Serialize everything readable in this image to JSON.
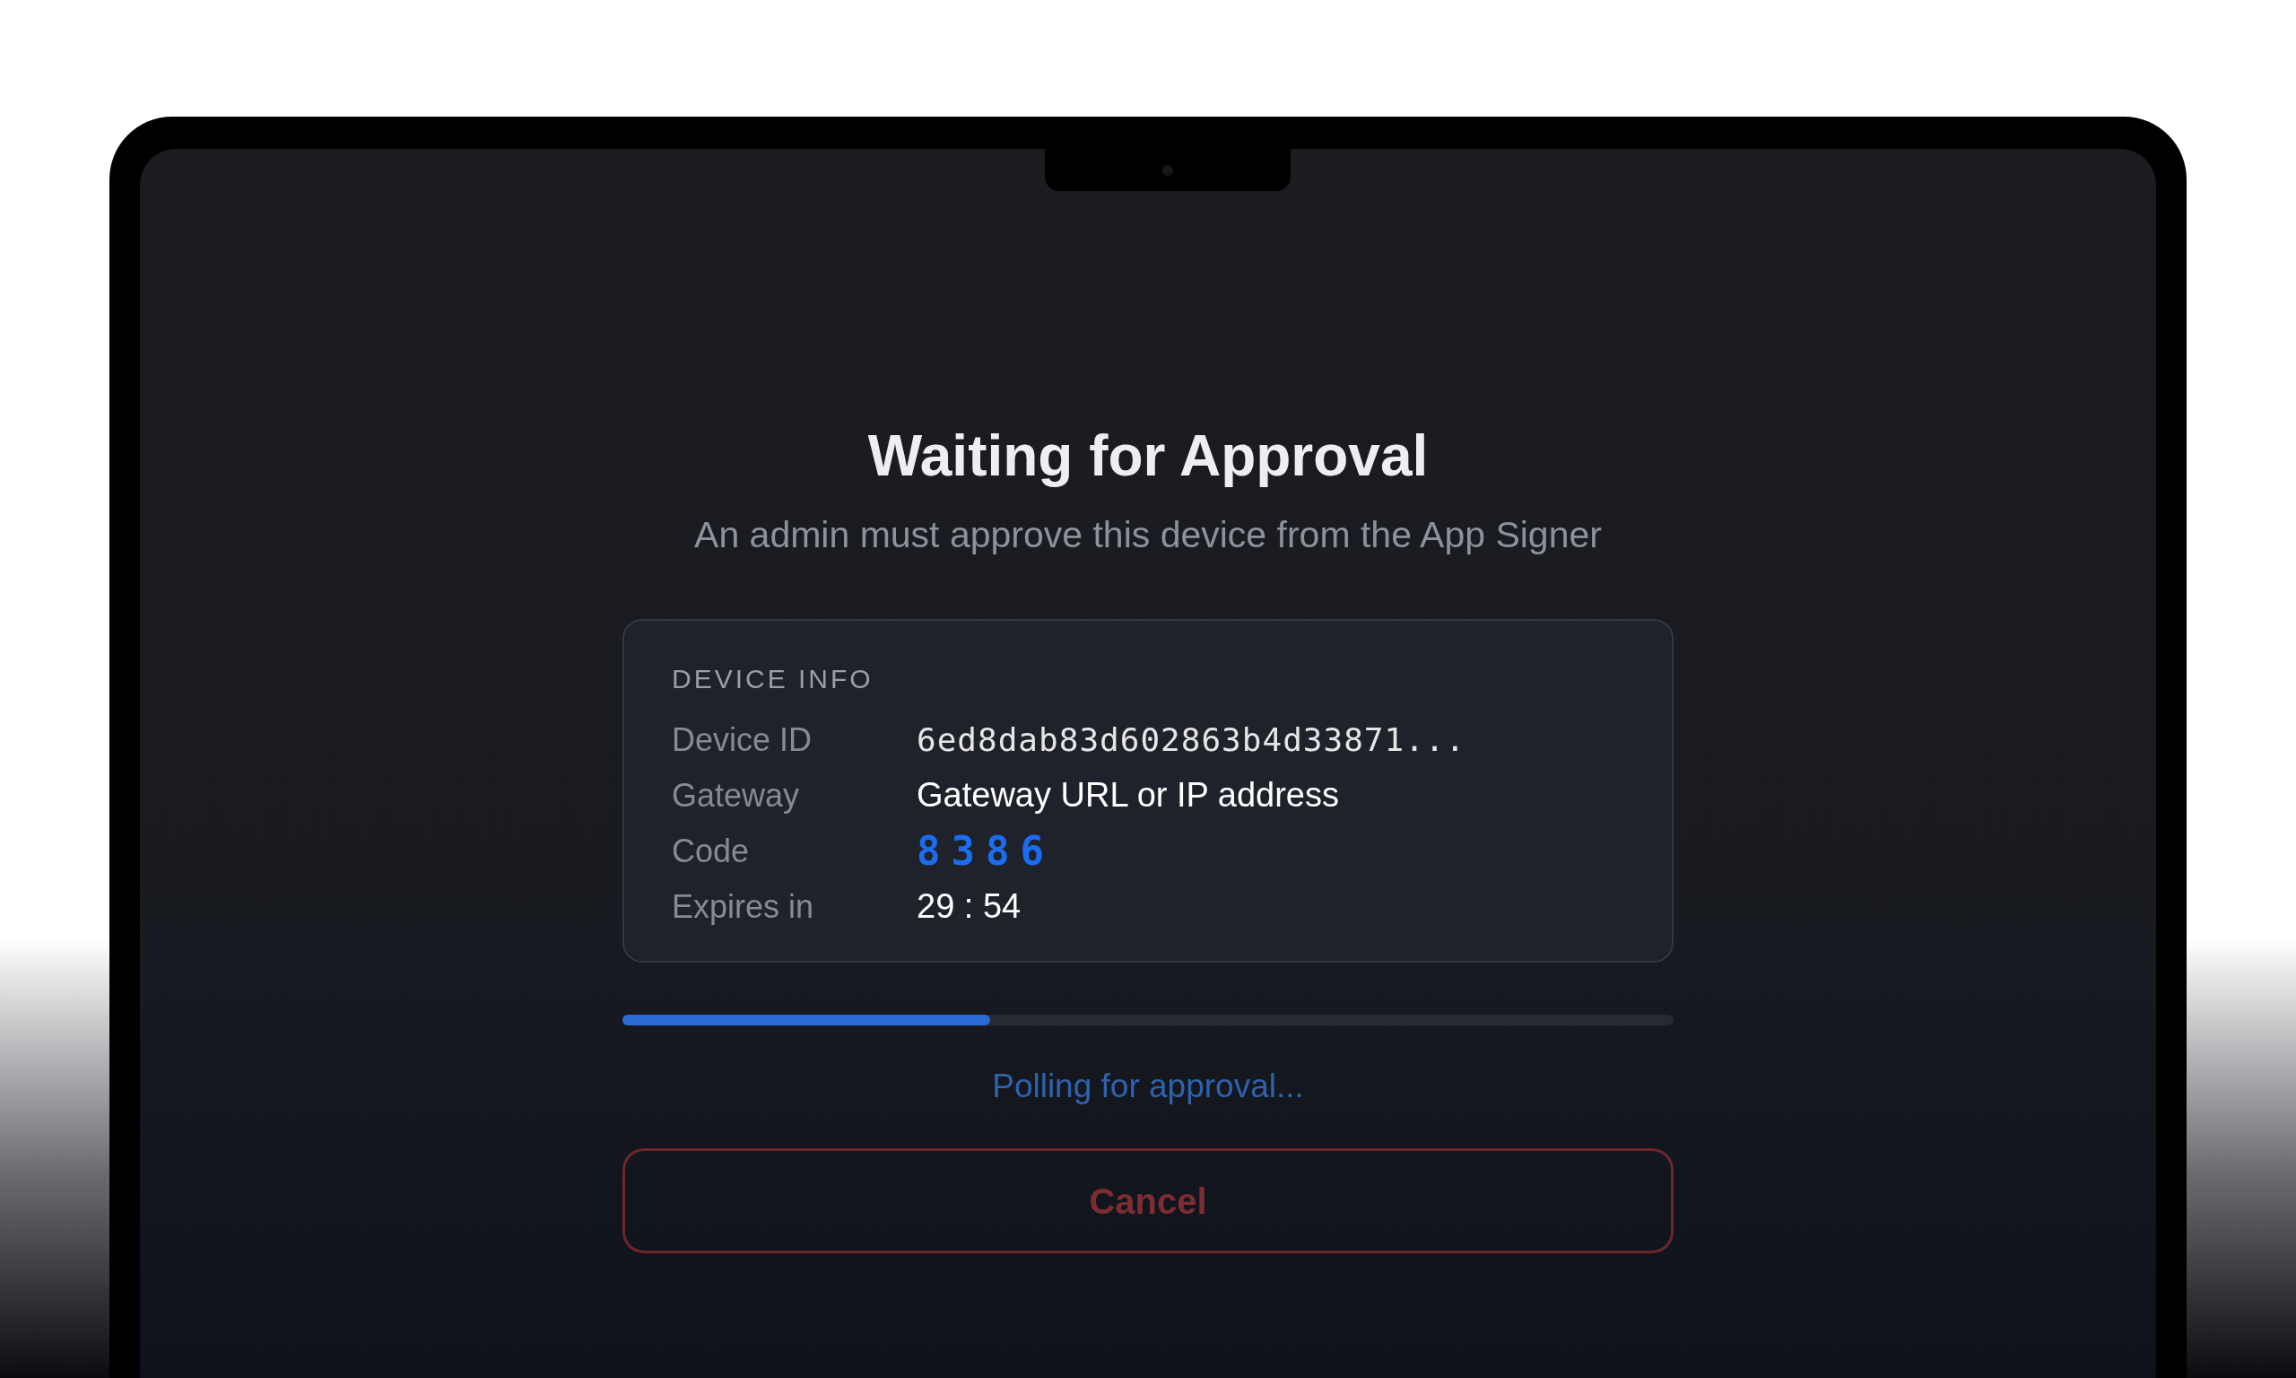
{
  "screen": {
    "title": "Waiting for Approval",
    "subtitle": "An admin must approve this device from the App Signer"
  },
  "device_info": {
    "heading": "DEVICE INFO",
    "rows": [
      {
        "kind": "mono",
        "label": "Device ID",
        "value": "6ed8dab83d602863b4d33871..."
      },
      {
        "kind": "text",
        "label": "Gateway",
        "value": "Gateway URL or IP address"
      },
      {
        "kind": "code",
        "label": "Code",
        "value": "8386"
      },
      {
        "kind": "text",
        "label": "Expires in",
        "value": "29 : 54"
      }
    ]
  },
  "progress": {
    "level": 0.35
  },
  "status": "Polling for approval...",
  "buttons": [
    {
      "label": "Cancel"
    }
  ]
}
